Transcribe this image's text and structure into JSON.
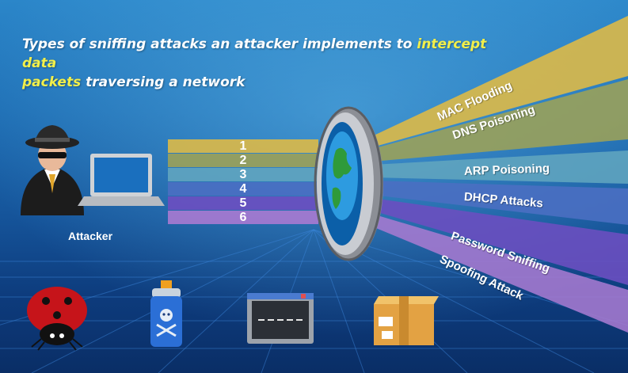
{
  "title": {
    "part1": "Types of sniffing attacks an attacker implements to ",
    "highlight1": "intercept data",
    "highlight2": "packets",
    "part2": " traversing a network"
  },
  "attacker_label": "Attacker",
  "packet_numbers": [
    "1",
    "2",
    "3",
    "4",
    "5",
    "6"
  ],
  "attacks": [
    {
      "label": "MAC Flooding",
      "color": "#d9b84a"
    },
    {
      "label": "DNS Poisoning",
      "color": "#9aa15a"
    },
    {
      "label": "ARP Poisoning",
      "color": "#5fa4bf"
    },
    {
      "label": "DHCP Attacks",
      "color": "#4a6fc2"
    },
    {
      "label": "Password Sniffing",
      "color": "#6a4fc0"
    },
    {
      "label": "Spoofing Attack",
      "color": "#a67ad0"
    }
  ],
  "colors": {
    "title_text": "#ffffff",
    "title_highlight": "#f2ef4a",
    "background_top": "#2b86c9",
    "background_bottom": "#0a2e66"
  },
  "icons": [
    "spy-attacker-icon",
    "laptop-icon",
    "lens-globe-icon",
    "ladybug-icon",
    "poison-spray-icon",
    "terminal-window-icon",
    "package-box-icon"
  ]
}
